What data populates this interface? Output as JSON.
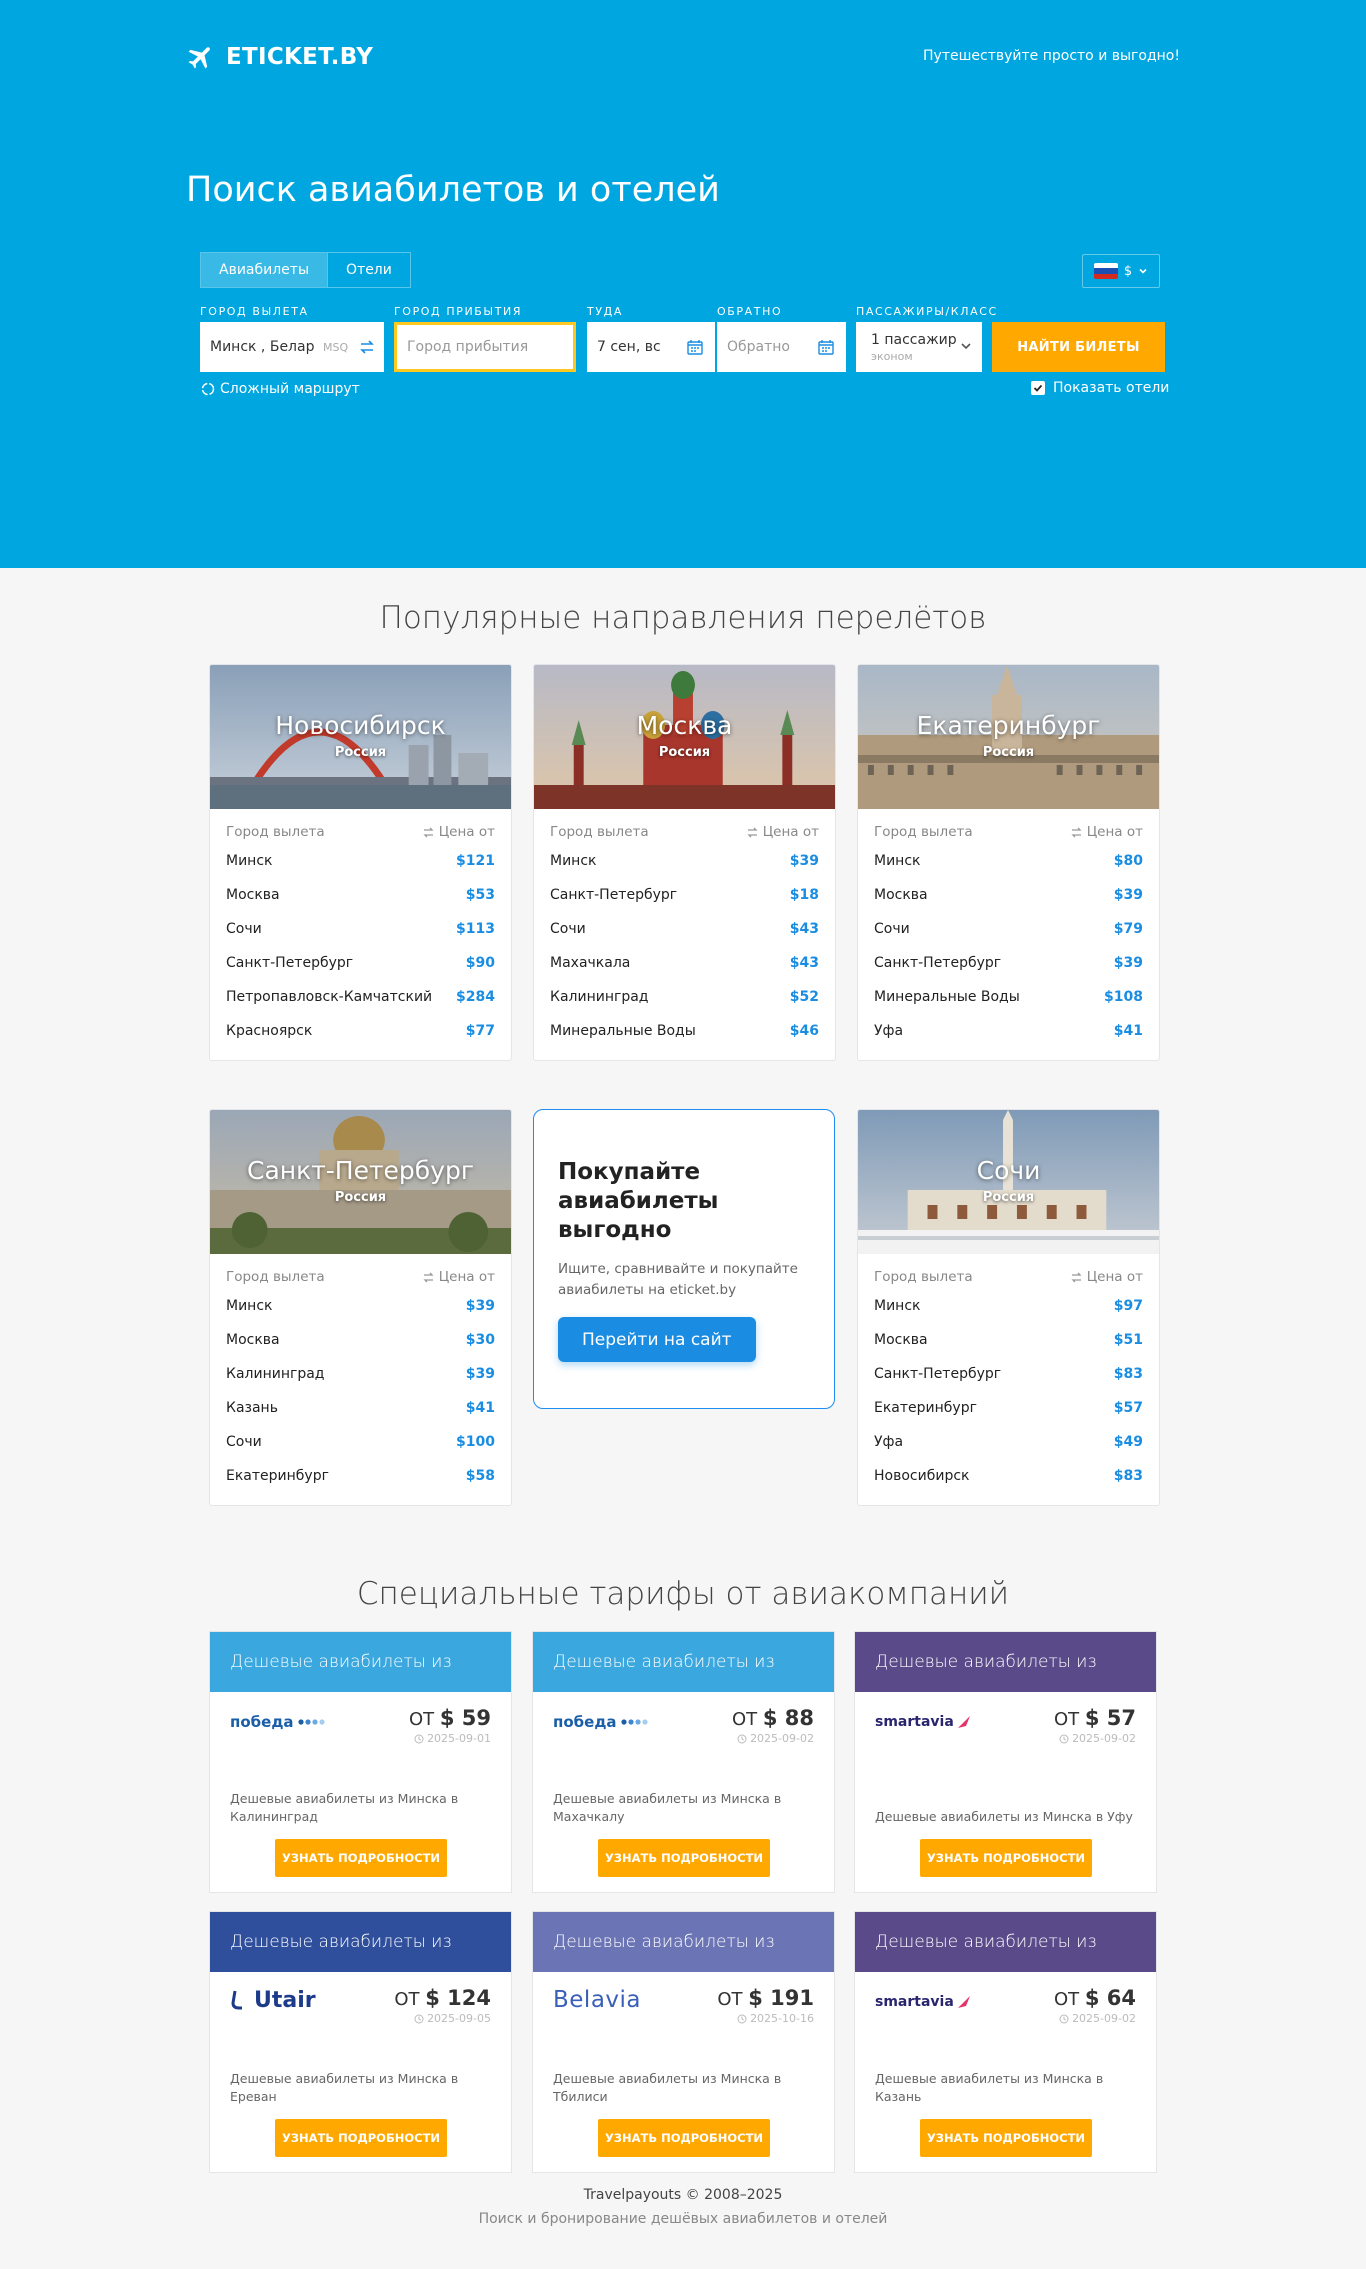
{
  "header": {
    "logo_text": "ETICKET.BY",
    "tagline": "Путешествуйте просто и выгодно!",
    "title": "Поиск авиабилетов и отелей"
  },
  "search": {
    "tabs": [
      {
        "label": "Авиабилеты",
        "active": true
      },
      {
        "label": "Отели",
        "active": false
      }
    ],
    "currency": "$",
    "origin_label": "Город вылета",
    "origin_value": "Минск , Белару",
    "origin_code": "MSQ",
    "destination_label": "Город прибытия",
    "destination_placeholder": "Город прибытия",
    "depart_label": "Туда",
    "depart_value": "7 сен, вс",
    "return_label": "Обратно",
    "return_placeholder": "Обратно",
    "pax_label": "Пассажиры/класс",
    "pax_value": "1 пассажир",
    "pax_class": "эконом",
    "submit_label": "НАЙТИ БИЛЕТЫ",
    "complex_route": "Сложный маршрут",
    "show_hotels": "Показать отели"
  },
  "popular": {
    "title": "Популярные направления перелётов",
    "col_origin": "Город вылета",
    "col_price": "Цена от",
    "destinations": [
      {
        "city": "Новосибирск",
        "country": "Россия",
        "rows": [
          {
            "from": "Минск",
            "price": "$121"
          },
          {
            "from": "Москва",
            "price": "$53"
          },
          {
            "from": "Сочи",
            "price": "$113"
          },
          {
            "from": "Санкт-Петербург",
            "price": "$90"
          },
          {
            "from": "Петропавловск-Камчатский",
            "price": "$284"
          },
          {
            "from": "Красноярск",
            "price": "$77"
          }
        ]
      },
      {
        "city": "Москва",
        "country": "Россия",
        "rows": [
          {
            "from": "Минск",
            "price": "$39"
          },
          {
            "from": "Санкт-Петербург",
            "price": "$18"
          },
          {
            "from": "Сочи",
            "price": "$43"
          },
          {
            "from": "Махачкала",
            "price": "$43"
          },
          {
            "from": "Калининград",
            "price": "$52"
          },
          {
            "from": "Минеральные Воды",
            "price": "$46"
          }
        ]
      },
      {
        "city": "Екатеринбург",
        "country": "Россия",
        "rows": [
          {
            "from": "Минск",
            "price": "$80"
          },
          {
            "from": "Москва",
            "price": "$39"
          },
          {
            "from": "Сочи",
            "price": "$79"
          },
          {
            "from": "Санкт-Петербург",
            "price": "$39"
          },
          {
            "from": "Минеральные Воды",
            "price": "$108"
          },
          {
            "from": "Уфа",
            "price": "$41"
          }
        ]
      },
      {
        "city": "Санкт-Петербург",
        "country": "Россия",
        "rows": [
          {
            "from": "Минск",
            "price": "$39"
          },
          {
            "from": "Москва",
            "price": "$30"
          },
          {
            "from": "Калининград",
            "price": "$39"
          },
          {
            "from": "Казань",
            "price": "$41"
          },
          {
            "from": "Сочи",
            "price": "$100"
          },
          {
            "from": "Екатеринбург",
            "price": "$58"
          }
        ]
      },
      {
        "city": "Сочи",
        "country": "Россия",
        "rows": [
          {
            "from": "Минск",
            "price": "$97"
          },
          {
            "from": "Москва",
            "price": "$51"
          },
          {
            "from": "Санкт-Петербург",
            "price": "$83"
          },
          {
            "from": "Екатеринбург",
            "price": "$57"
          },
          {
            "from": "Уфа",
            "price": "$49"
          },
          {
            "from": "Новосибирск",
            "price": "$83"
          }
        ]
      }
    ],
    "promo": {
      "title": "Покупайте авиабилеты выгодно",
      "text": "Ищите, сравнивайте и покупайте авиабилеты на eticket.by",
      "button": "Перейти на сайт"
    }
  },
  "fares": {
    "title": "Специальные тарифы от авиакомпаний",
    "prefix": "ОТ",
    "button": "УЗНАТЬ ПОДРОБНОСТИ",
    "cards": [
      {
        "header": "Дешевые авиабилеты из Минска",
        "color": "#3aa7df",
        "airline": "победа",
        "price": "$ 59",
        "date": "2025-09-01",
        "desc": "Дешевые авиабилеты из Минска в Калининград"
      },
      {
        "header": "Дешевые авиабилеты из Минска",
        "color": "#3aa7df",
        "airline": "победа",
        "price": "$ 88",
        "date": "2025-09-02",
        "desc": "Дешевые авиабилеты из Минска в Махачкалу"
      },
      {
        "header": "Дешевые авиабилеты из Минска",
        "color": "#5b4a8a",
        "airline": "smartavia",
        "price": "$ 57",
        "date": "2025-09-02",
        "desc": "Дешевые авиабилеты из Минска в Уфу"
      },
      {
        "header": "Дешевые авиабилеты из Минска",
        "color": "#2f4f9c",
        "airline": "Utair",
        "price": "$ 124",
        "date": "2025-09-05",
        "desc": "Дешевые авиабилеты из Минска в Ереван"
      },
      {
        "header": "Дешевые авиабилеты из Минска",
        "color": "#6b74b4",
        "airline": "Belavia",
        "price": "$ 191",
        "date": "2025-10-16",
        "desc": "Дешевые авиабилеты из Минска в Тбилиси"
      },
      {
        "header": "Дешевые авиабилеты из Минска",
        "color": "#5b4a8a",
        "airline": "smartavia",
        "price": "$ 64",
        "date": "2025-09-02",
        "desc": "Дешевые авиабилеты из Минска в Казань"
      }
    ]
  },
  "footer": {
    "copyright": "Travelpayouts © 2008–2025",
    "tagline": "Поиск и бронирование дешёвых авиабилетов и отелей"
  }
}
